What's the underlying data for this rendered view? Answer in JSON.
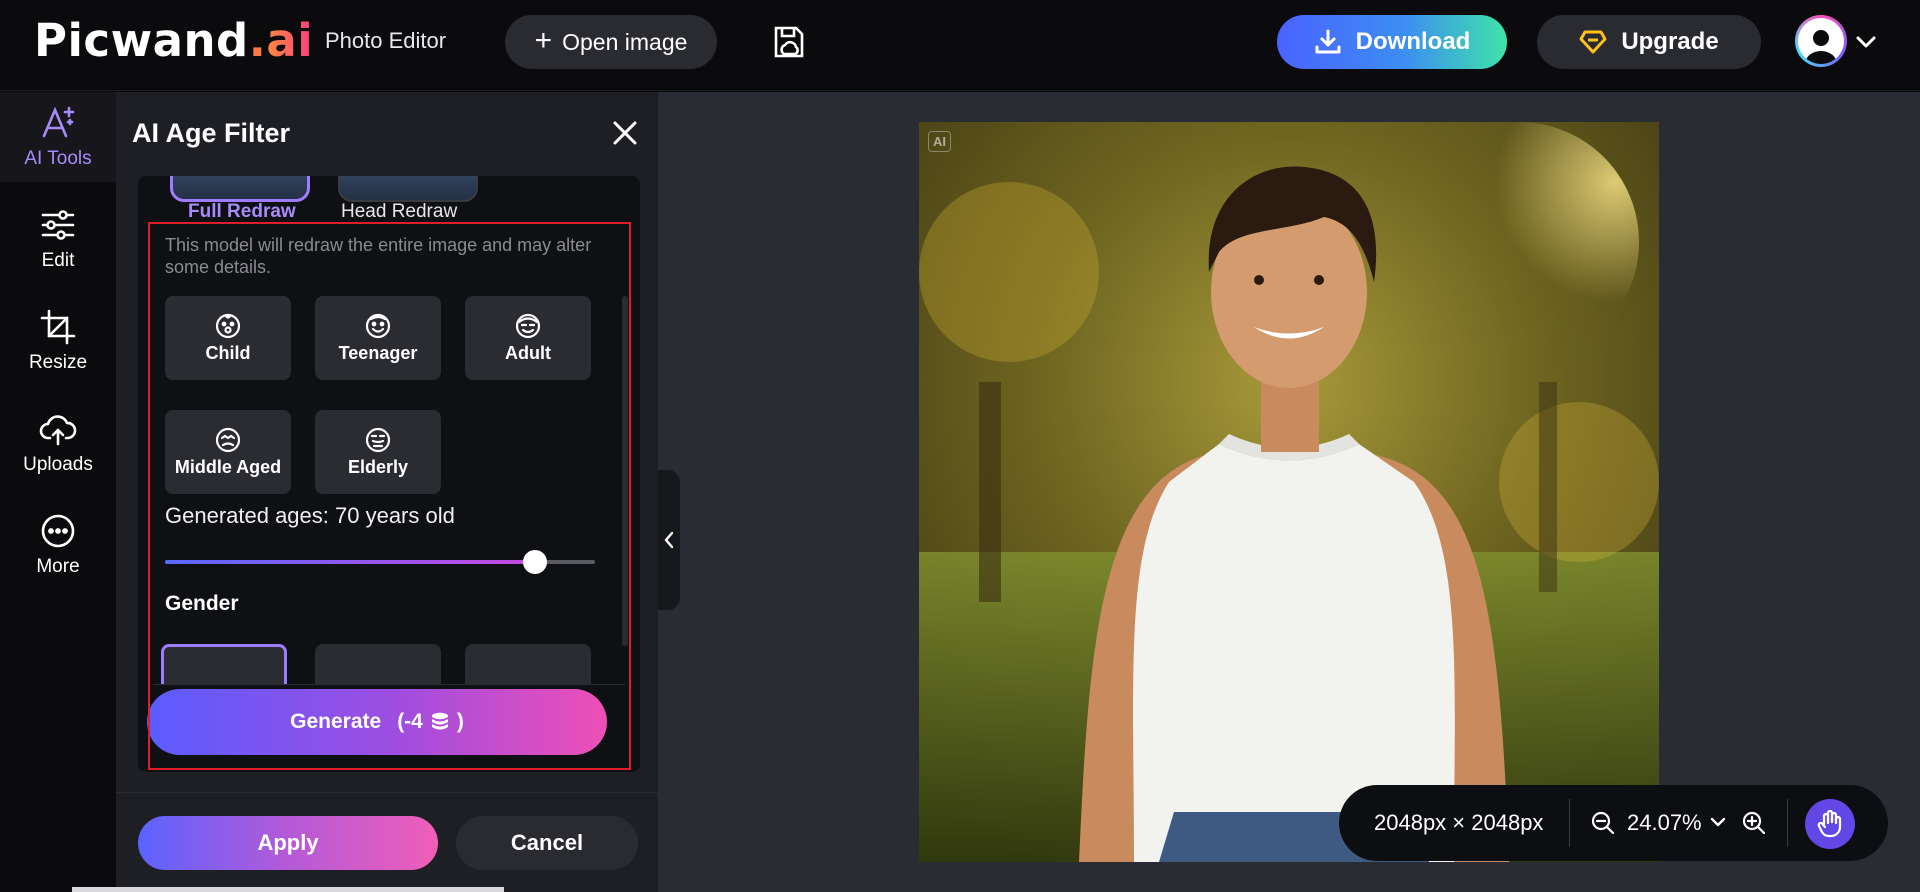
{
  "header": {
    "logo_main": "Picwand",
    "logo_dot": ".",
    "logo_ai": "ai",
    "app_title": "Photo Editor",
    "open_label": "Open image",
    "download_label": "Download",
    "upgrade_label": "Upgrade"
  },
  "nav": {
    "items": [
      {
        "label": "AI Tools",
        "icon": "ai-tools-icon"
      },
      {
        "label": "Edit",
        "icon": "sliders-icon"
      },
      {
        "label": "Resize",
        "icon": "crop-icon"
      },
      {
        "label": "Uploads",
        "icon": "cloud-upload-icon"
      },
      {
        "label": "More",
        "icon": "more-icon"
      }
    ]
  },
  "panel": {
    "title": "AI Age Filter",
    "modes": [
      "Full Redraw",
      "Head Redraw"
    ],
    "selected_mode": "Full Redraw",
    "description": "This model will redraw the entire image and may alter some details.",
    "ages": [
      "Child",
      "Teenager",
      "Adult",
      "Middle Aged",
      "Elderly"
    ],
    "generated_ages": "Generated ages: 70 years old",
    "slider_fraction": 0.86,
    "gender_label": "Gender",
    "generate_label": "Generate",
    "generate_cost": "(-4",
    "generate_close": ")",
    "apply_label": "Apply",
    "cancel_label": "Cancel"
  },
  "canvas": {
    "ai_badge": "AI",
    "dimensions": "2048px × 2048px",
    "zoom": "24.07%"
  },
  "colors": {
    "accent": "#9d7cff",
    "frame": "#e01e2b",
    "hand_button": "#6347e6"
  }
}
